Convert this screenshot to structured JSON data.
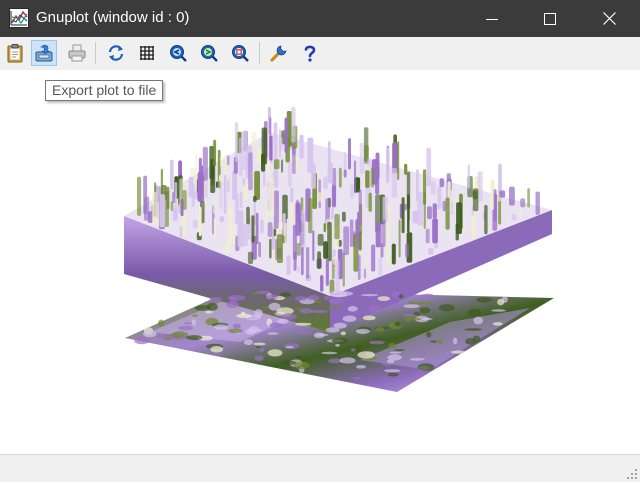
{
  "window": {
    "title": "Gnuplot (window id : 0)",
    "app_icon": "gnuplot-app-icon",
    "controls": [
      "minimize-icon",
      "maximize-icon",
      "close-icon"
    ],
    "titlebar_color": "#3b3b3b"
  },
  "toolbar": {
    "buttons": [
      {
        "icon": "clipboard-icon",
        "state": "normal"
      },
      {
        "icon": "export-icon",
        "state": "pressed"
      },
      {
        "icon": "print-icon",
        "state": "disabled"
      },
      {
        "icon": "replot-icon",
        "state": "normal"
      },
      {
        "icon": "grid-icon",
        "state": "normal"
      },
      {
        "icon": "zoom-back-icon",
        "state": "normal"
      },
      {
        "icon": "zoom-forward-icon",
        "state": "normal"
      },
      {
        "icon": "zoom-all-icon",
        "state": "normal"
      },
      {
        "icon": "options-wrench-icon",
        "state": "normal"
      },
      {
        "icon": "help-icon",
        "state": "normal"
      }
    ]
  },
  "tooltip": {
    "text": "Export plot to file"
  },
  "plot": {
    "description_icon": "3d-image-surface-plot",
    "colors": {
      "purple": "#9b6fc7",
      "lavender": "#d6c4ec",
      "green": "#6f8a2e",
      "dark_green": "#3d5a1e",
      "cream": "#f1efd0"
    }
  },
  "statusbar": {
    "text": ""
  }
}
